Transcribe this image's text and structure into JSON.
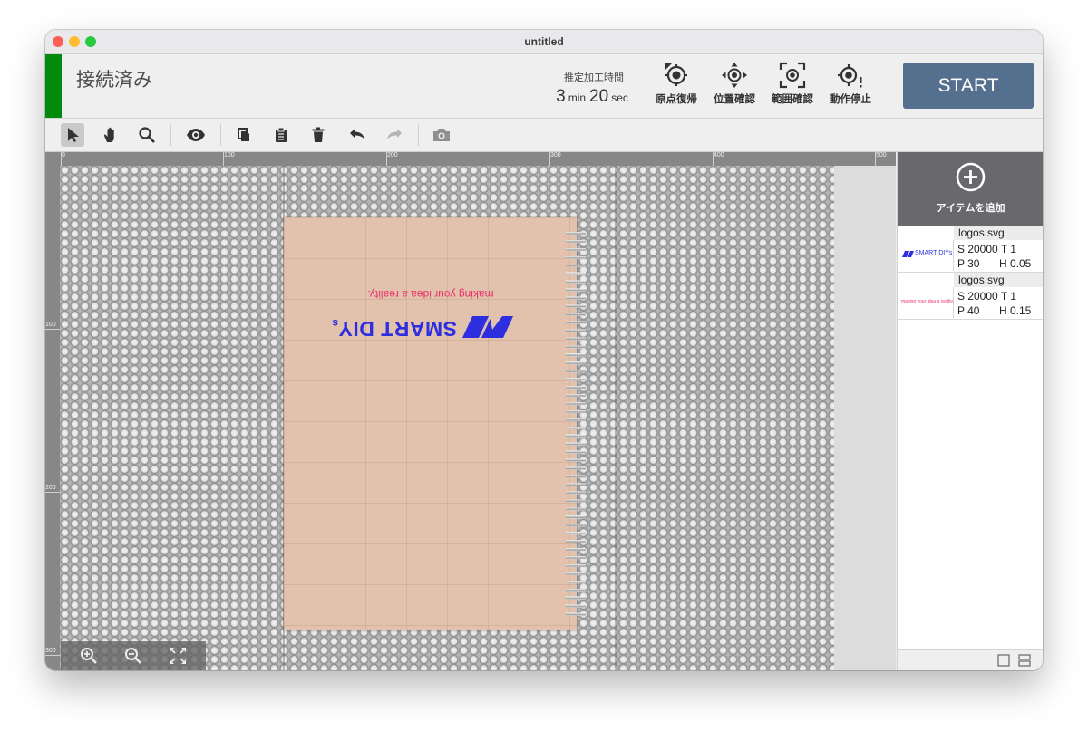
{
  "window": {
    "title": "untitled"
  },
  "header": {
    "status": "接続済み",
    "estimate_label": "推定加工時間",
    "estimate": {
      "min_value": "3",
      "min_unit": "min",
      "sec_value": "20",
      "sec_unit": "sec"
    },
    "actions": [
      {
        "label": "原点復帰",
        "icon": "home-origin-icon"
      },
      {
        "label": "位置確認",
        "icon": "position-check-icon"
      },
      {
        "label": "範囲確認",
        "icon": "range-check-icon"
      },
      {
        "label": "動作停止",
        "icon": "stop-motion-icon"
      }
    ],
    "start_label": "START",
    "status_color": "#028a0f",
    "start_color": "#55708f"
  },
  "toolbar": {
    "tools": [
      "select-arrow-icon",
      "hand-pan-icon",
      "zoom-search-icon",
      "eye-preview-icon",
      "copy-icon",
      "paste-clipboard-icon",
      "delete-trash-icon",
      "undo-icon",
      "redo-icon",
      "camera-icon"
    ],
    "active_tool": "select-arrow-icon"
  },
  "canvas": {
    "ruler_top": [
      "0",
      "100",
      "200",
      "300",
      "400",
      "500"
    ],
    "ruler_left": [
      "100",
      "200",
      "300"
    ],
    "engraving": {
      "tagline": "making your idea a reality.",
      "logo_text": "SMART DIY",
      "logo_sub": "s",
      "tagline_color": "#e8336b",
      "logo_color": "#2c2ee0"
    },
    "zoom_controls": [
      "zoom-in-icon",
      "zoom-out-icon",
      "fit-screen-icon"
    ]
  },
  "panel": {
    "add_label": "アイテムを追加",
    "items": [
      {
        "file": "logos.svg",
        "line1": "S 20000 T 1",
        "p": "P 30",
        "h": "H 0.05",
        "thumb_text": "SMART DIYs"
      },
      {
        "file": "logos.svg",
        "line1": "S 20000 T 1",
        "p": "P 40",
        "h": "H 0.15",
        "thumb_text": "making your idea a reality."
      }
    ],
    "footer_icons": [
      "single-view-icon",
      "split-view-icon"
    ]
  }
}
